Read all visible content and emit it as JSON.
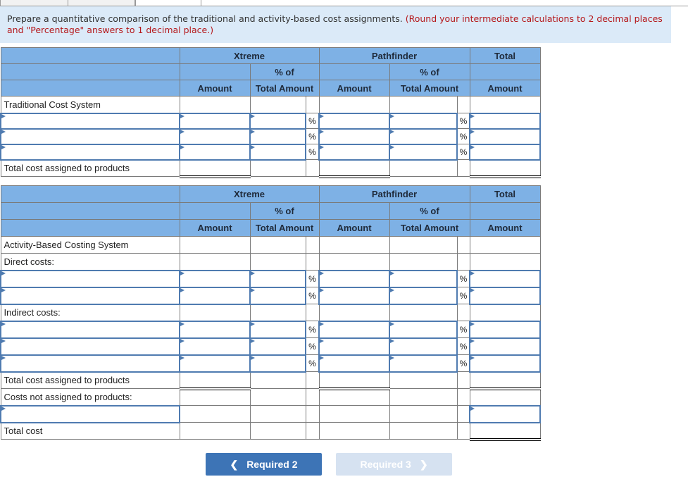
{
  "tabs": [
    {
      "label": ""
    },
    {
      "label": ""
    },
    {
      "label": "",
      "active": true
    }
  ],
  "instructions": {
    "main": "Prepare a quantitative comparison of the traditional and activity-based cost assignments. ",
    "note": "(Round your intermediate calculations to 2 decimal places and \"Percentage\" answers to 1 decimal place.)"
  },
  "header": {
    "group1": "Xtreme",
    "group2": "Pathfinder",
    "group3": "Total",
    "pct_of": "% of",
    "amount": "Amount",
    "total_amount": "Total Amount"
  },
  "traditional": {
    "title": "Traditional Cost System",
    "input_rows": 3,
    "total_label": "Total cost assigned to products"
  },
  "abc": {
    "title": "Activity-Based Costing System",
    "direct_label": "Direct costs:",
    "direct_rows": 2,
    "indirect_label": "Indirect costs:",
    "indirect_rows": 3,
    "total_label": "Total cost assigned to products",
    "not_assigned_label": "Costs not assigned to products:",
    "total_cost_label": "Total cost"
  },
  "pct_symbol": "%",
  "nav": {
    "prev_label": "Required 2",
    "next_label": "Required 3",
    "next_disabled": true
  }
}
